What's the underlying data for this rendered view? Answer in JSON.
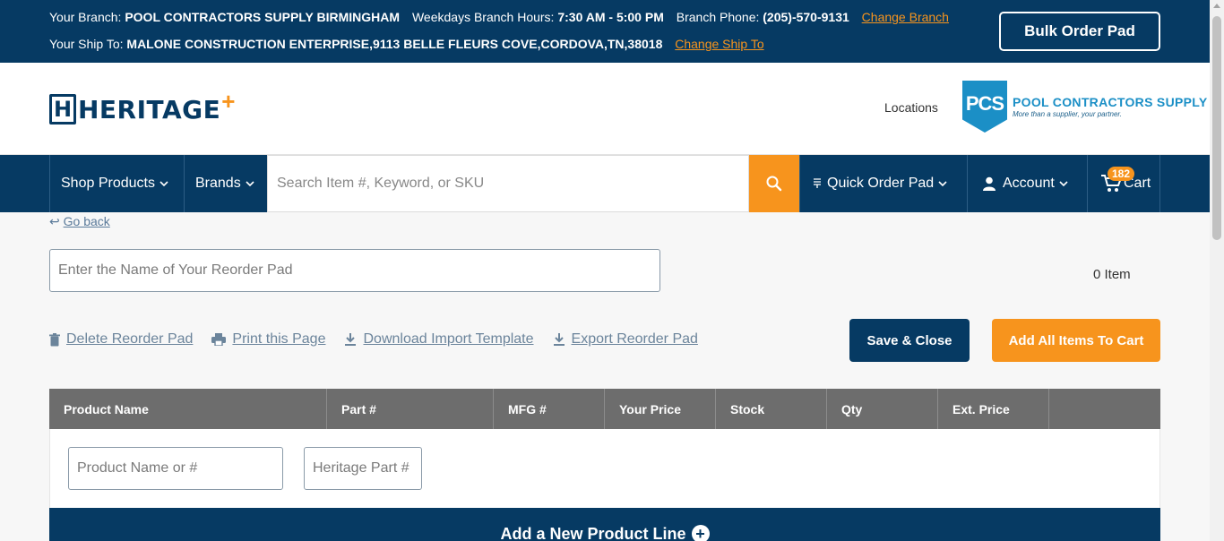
{
  "topbar": {
    "branch_label": "Your Branch:",
    "branch_name": "POOL CONTRACTORS SUPPLY BIRMINGHAM",
    "hours_label": "Weekdays Branch Hours:",
    "hours_value": "7:30 AM - 5:00 PM",
    "phone_label": "Branch Phone:",
    "phone_value": "(205)-570-9131",
    "change_branch": "Change Branch",
    "ship_label": "Your Ship To:",
    "ship_value": "MALONE CONSTRUCTION ENTERPRISE,9113 BELLE FLEURS COVE,CORDOVA,TN,38018",
    "change_ship": "Change Ship To",
    "bulk_order": "Bulk Order Pad"
  },
  "header": {
    "logo_text": "HERITAGE",
    "logo_letter": "H",
    "logo_plus": "+",
    "locations": "Locations",
    "pcs_abbr": "PCS",
    "pcs_title": "POOL CONTRACTORS SUPPLY",
    "pcs_tagline": "More than a supplier, your partner."
  },
  "nav": {
    "shop_products": "Shop Products",
    "brands": "Brands",
    "search_placeholder": "Search Item #, Keyword, or SKU",
    "quick_order": "Quick Order Pad",
    "account": "Account",
    "cart": "Cart",
    "cart_count": "182"
  },
  "page": {
    "go_back": "Go back",
    "pad_name_placeholder": "Enter the Name of Your Reorder Pad",
    "item_count": "0 Item",
    "actions": {
      "delete": "Delete Reorder Pad",
      "print": "Print this Page",
      "download": "Download Import Template",
      "export": "Export Reorder Pad"
    },
    "save_close": "Save & Close",
    "add_all": "Add All Items To Cart"
  },
  "table": {
    "columns": [
      "Product Name",
      "Part #",
      "MFG #",
      "Your Price",
      "Stock",
      "Qty",
      "Ext. Price",
      ""
    ],
    "product_placeholder": "Product Name or #",
    "part_placeholder": "Heritage Part #",
    "add_line": "Add a New Product Line"
  },
  "colors": {
    "navy": "#063a63",
    "orange": "#f7941d",
    "pcs_blue": "#1b8fc6"
  }
}
